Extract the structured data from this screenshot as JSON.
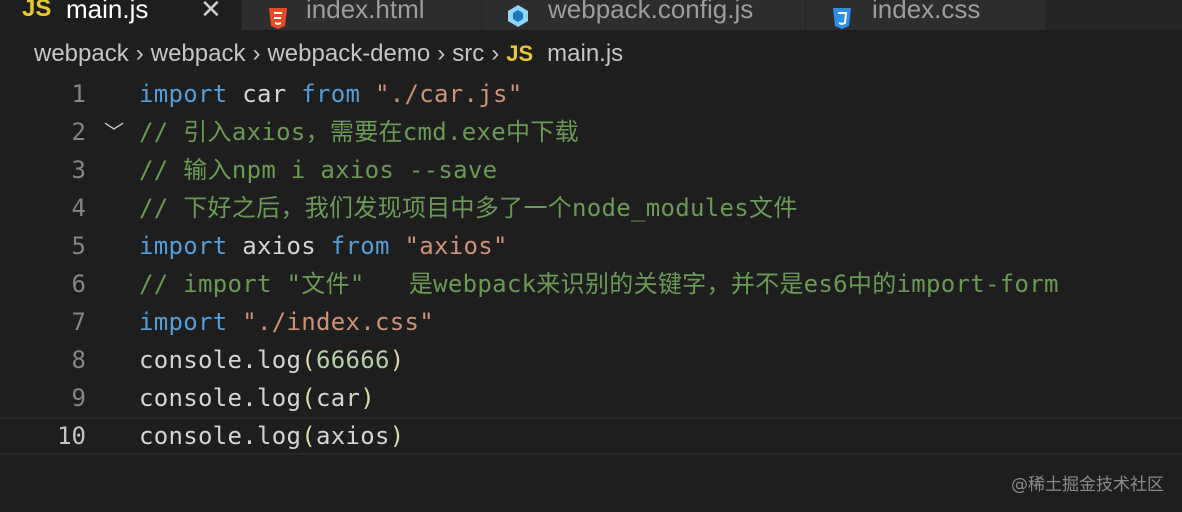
{
  "tabs": [
    {
      "label": "main.js",
      "icon": "js-file-icon",
      "icon_text": "JS",
      "active": true
    },
    {
      "label": "index.html",
      "icon": "html-file-icon",
      "active": false
    },
    {
      "label": "webpack.config.js",
      "icon": "webpack-config-icon",
      "active": false
    },
    {
      "label": "index.css",
      "icon": "css-file-icon",
      "active": false
    }
  ],
  "close_glyph": "✕",
  "breadcrumb": {
    "items": [
      "webpack",
      "webpack",
      "webpack-demo",
      "src"
    ],
    "separator": "›",
    "file_badge": "JS",
    "file": "main.js"
  },
  "line_numbers": [
    "1",
    "2",
    "3",
    "4",
    "5",
    "6",
    "7",
    "8",
    "9",
    "10"
  ],
  "fold_marker": "﹀",
  "code": {
    "l1": {
      "kw1": "import",
      "id": " car ",
      "kw2": "from",
      "str": " \"./car.js\""
    },
    "l2": "// 引入axios，需要在cmd.exe中下载",
    "l3": "// 输入npm i axios --save",
    "l4": "// 下好之后，我们发现项目中多了一个node_modules文件",
    "l5": {
      "kw1": "import",
      "id": " axios ",
      "kw2": "from",
      "str": " \"axios\""
    },
    "l6": "// import \"文件\"   是webpack来识别的关键字，并不是es6中的import-form",
    "l7": {
      "kw": "import",
      "str": " \"./index.css\""
    },
    "l8": {
      "obj": "console",
      "dot": ".",
      "fn": "log",
      "open": "(",
      "arg": "66666",
      "close": ")"
    },
    "l9": {
      "obj": "console",
      "dot": ".",
      "fn": "log",
      "open": "(",
      "arg": "car",
      "close": ")"
    },
    "l10": {
      "obj": "console",
      "dot": ".",
      "fn": "log",
      "open": "(",
      "arg": "axios",
      "close": ")"
    }
  },
  "watermark": "@稀土掘金技术社区",
  "colors": {
    "keyword": "#569cd6",
    "string": "#ce9178",
    "comment": "#6a9955",
    "number": "#b5cea8",
    "js_badge": "#e8c832",
    "background": "#1e1e1e"
  }
}
